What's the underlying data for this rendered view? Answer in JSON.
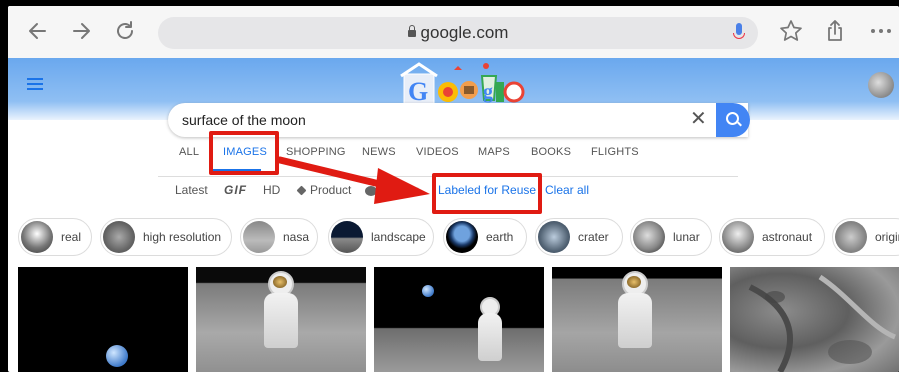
{
  "browser": {
    "url": "google.com",
    "back_icon": "back-arrow-icon",
    "forward_icon": "forward-arrow-icon",
    "reload_icon": "reload-icon"
  },
  "search": {
    "query": "surface of the moon"
  },
  "tabs": [
    "ALL",
    "IMAGES",
    "SHOPPING",
    "NEWS",
    "VIDEOS",
    "MAPS",
    "BOOKS",
    "FLIGHTS"
  ],
  "active_tab": "IMAGES",
  "filters": {
    "latest": "Latest",
    "gif": "GIF",
    "hd": "HD",
    "product": "Product",
    "color": "Color",
    "labeled_for_reuse": "Labeled for Reuse",
    "clear_all": "Clear all"
  },
  "chips": [
    "real",
    "high resolution",
    "nasa",
    "landscape",
    "earth",
    "crater",
    "lunar",
    "astronaut",
    "origin"
  ],
  "colors": {
    "accent": "#1a73e8",
    "highlight": "#e01b12",
    "search_button": "#4285f4"
  }
}
